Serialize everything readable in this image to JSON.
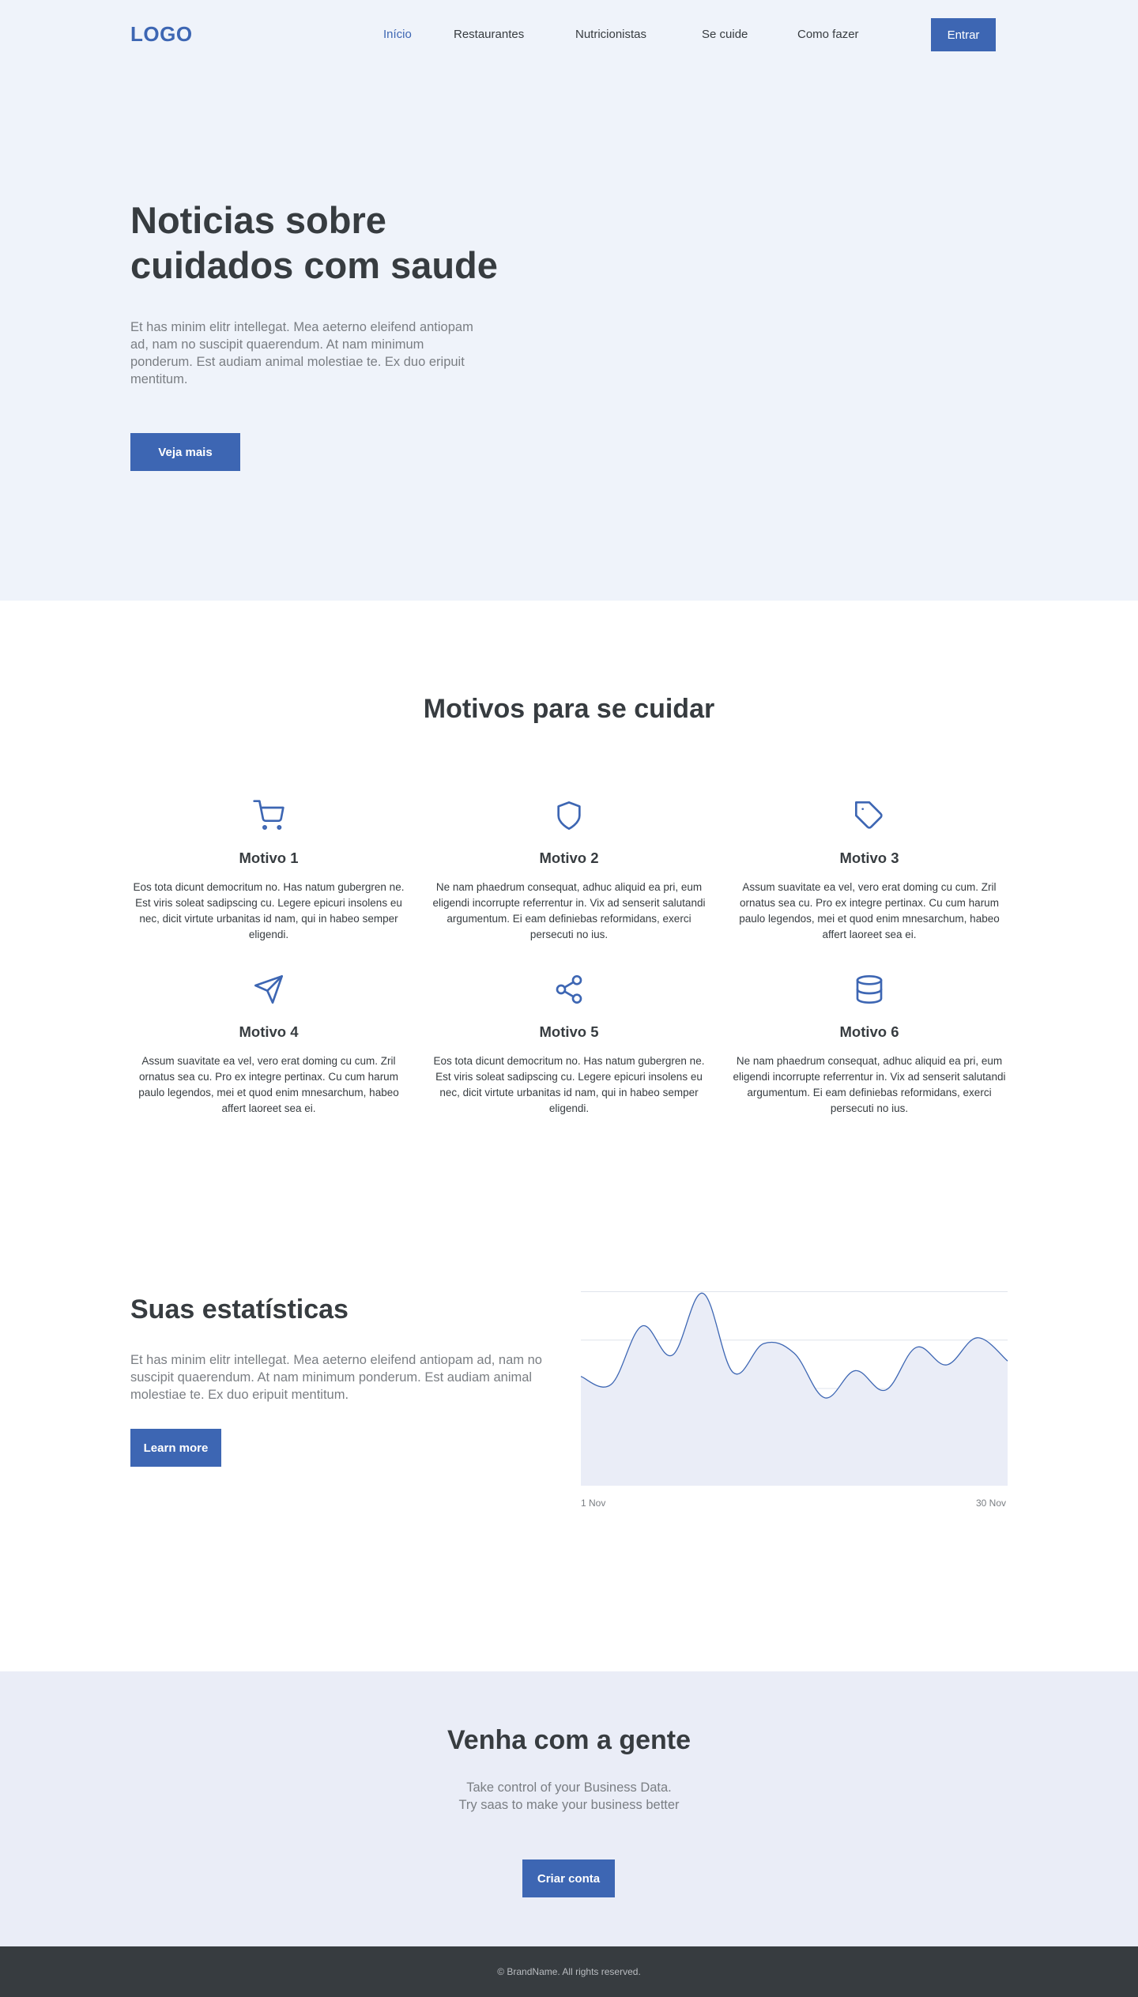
{
  "nav": {
    "logo": "LOGO",
    "links": [
      "Início",
      "Restaurantes",
      "Nutricionistas",
      "Se cuide",
      "Como fazer"
    ],
    "button": "Entrar"
  },
  "hero": {
    "title": "Noticias sobre cuidados com saude",
    "text": "Et has minim elitr intellegat. Mea aeterno eleifend antiopam ad, nam no suscipit quaerendum. At nam minimum ponderum. Est audiam animal molestiae te. Ex duo eripuit mentitum.",
    "button": "Veja mais"
  },
  "features": {
    "title": "Motivos para se cuidar",
    "items": [
      {
        "icon": "cart-icon",
        "title": "Motivo 1",
        "text": "Eos tota dicunt democritum no. Has natum gubergren ne. Est viris soleat sadipscing cu. Legere epicuri insolens eu nec, dicit virtute urbanitas id nam, qui in habeo semper eligendi."
      },
      {
        "icon": "shield-icon",
        "title": "Motivo 2",
        "text": "Ne nam phaedrum consequat, adhuc aliquid ea pri, eum eligendi incorrupte referrentur in. Vix ad senserit salutandi argumentum. Ei eam definiebas reformidans, exerci persecuti no ius."
      },
      {
        "icon": "tag-icon",
        "title": "Motivo 3",
        "text": "Assum suavitate ea vel, vero erat doming cu cum. Zril ornatus sea cu. Pro ex integre pertinax. Cu cum harum paulo legendos, mei et quod enim mnesarchum, habeo affert laoreet sea ei."
      },
      {
        "icon": "send-icon",
        "title": "Motivo 4",
        "text": "Assum suavitate ea vel, vero erat doming cu cum. Zril ornatus sea cu. Pro ex integre pertinax. Cu cum harum paulo legendos, mei et quod enim mnesarchum, habeo affert laoreet sea ei."
      },
      {
        "icon": "share-icon",
        "title": "Motivo 5",
        "text": "Eos tota dicunt democritum no. Has natum gubergren ne. Est viris soleat sadipscing cu. Legere epicuri insolens eu nec, dicit virtute urbanitas id nam, qui in habeo semper eligendi."
      },
      {
        "icon": "database-icon",
        "title": "Motivo 6",
        "text": "Ne nam phaedrum consequat, adhuc aliquid ea pri, eum eligendi incorrupte referrentur in. Vix ad senserit salutandi argumentum. Ei eam definiebas reformidans, exerci persecuti no ius."
      }
    ]
  },
  "stats": {
    "title": "Suas estatísticas",
    "text": "Et has minim elitr intellegat. Mea aeterno eleifend antiopam ad, nam no suscipit quaerendum. At nam minimum ponderum. Est audiam animal molestiae te. Ex duo eripuit mentitum.",
    "button": "Learn more"
  },
  "chart_data": {
    "type": "area",
    "x_start_label": "1 Nov",
    "x_end_label": "30 Nov",
    "values": [
      56,
      52,
      82,
      67,
      99,
      58,
      73,
      68,
      45,
      59,
      49,
      71,
      62,
      76,
      64
    ],
    "ylim": [
      0,
      100
    ],
    "grid": true,
    "line_color": "#3d66b3",
    "fill_color": "#eaedf7"
  },
  "cta": {
    "title": "Venha com a gente",
    "line1": "Take control of your Business Data.",
    "line2": "Try saas to make your business better",
    "button": "Criar conta"
  },
  "footer": {
    "text": "© BrandName. All rights reserved."
  },
  "colors": {
    "accent": "#3d66b3",
    "hero_bg": "#eff3fa",
    "cta_bg": "#eaedf7",
    "footer_bg": "#373c40"
  }
}
